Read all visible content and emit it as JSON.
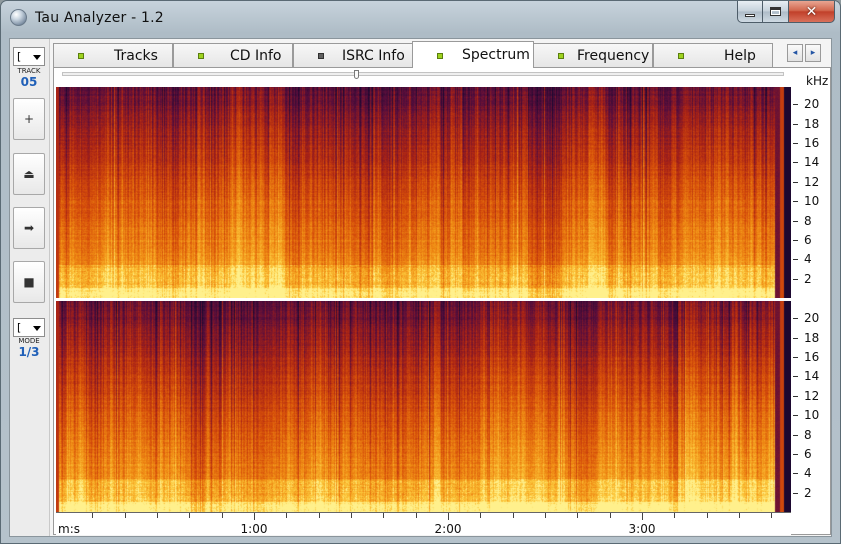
{
  "window": {
    "title": "Tau Analyzer - 1.2",
    "close_glyph": "✕"
  },
  "sidebar": {
    "track_combo_value": "[",
    "track_label": "TRACK",
    "track_value": "05",
    "buttons": [
      {
        "icon": "plus-icon",
        "glyph": "+"
      },
      {
        "icon": "eject-icon",
        "glyph": "⏏"
      },
      {
        "icon": "arrow-right-icon",
        "glyph": "➡"
      },
      {
        "icon": "stop-icon",
        "glyph": "■"
      }
    ],
    "mode_combo_value": "[",
    "mode_label": "MODE",
    "mode_value": "1/3"
  },
  "tabs": [
    {
      "label": "Tracks",
      "led": "on"
    },
    {
      "label": "CD Info",
      "led": "on"
    },
    {
      "label": "ISRC Info",
      "led": "off"
    },
    {
      "label": "Spectrum",
      "led": "on",
      "active": true
    },
    {
      "label": "Frequency",
      "led": "on"
    },
    {
      "label": "Help",
      "led": "on"
    }
  ],
  "tab_scroll": {
    "left_glyph": "◂",
    "right_glyph": "▸"
  },
  "spectrum": {
    "y_unit": "kHz",
    "y_ticks": [
      20,
      18,
      16,
      14,
      12,
      10,
      8,
      6,
      4,
      2
    ],
    "x_unit": "m:s",
    "x_labels": [
      "1:00",
      "2:00",
      "3:00"
    ],
    "channels": 2,
    "colors": {
      "low": "#2a0a3c",
      "mid": "#c8360a",
      "high": "#ffe060"
    }
  }
}
